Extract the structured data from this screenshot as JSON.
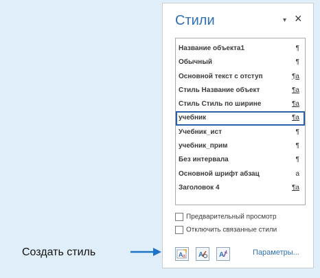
{
  "pane": {
    "title": "Стили",
    "menu_glyph": "▾",
    "close_glyph": "×"
  },
  "styles": [
    {
      "name": "Название объекта1",
      "marker": "¶",
      "type": "paragraph"
    },
    {
      "name": "Обычный",
      "marker": "¶",
      "type": "paragraph"
    },
    {
      "name": "Основной текст с отступ",
      "marker": "¶a",
      "type": "linked"
    },
    {
      "name": "Стиль Название объект",
      "marker": "¶a",
      "type": "linked"
    },
    {
      "name": "Стиль Стиль по ширине",
      "marker": "¶a",
      "type": "linked"
    },
    {
      "name": "учебник",
      "marker": "¶a",
      "type": "linked",
      "selected": true
    },
    {
      "name": "Учебник_ист",
      "marker": "¶",
      "type": "paragraph"
    },
    {
      "name": "учебник_прим",
      "marker": "¶",
      "type": "paragraph"
    },
    {
      "name": "Без интервала",
      "marker": "¶",
      "type": "paragraph"
    },
    {
      "name": "Основной шрифт абзац",
      "marker": "a",
      "type": "character"
    },
    {
      "name": "Заголовок 4",
      "marker": "¶a",
      "type": "linked"
    }
  ],
  "options": {
    "preview_label": "Предварительный просмотр",
    "preview_checked": false,
    "disable_linked_label": "Отключить связанные стили",
    "disable_linked_checked": false
  },
  "toolbar": {
    "new_style_icon": "new-style-icon",
    "style_inspector_icon": "style-inspector-icon",
    "manage_styles_icon": "manage-styles-icon",
    "params_label": "Параметры..."
  },
  "annotation": {
    "label": "Создать стиль",
    "arrow_color": "#1a73c9"
  },
  "colors": {
    "title": "#2e6fb7",
    "selection": "#2b5ea9"
  }
}
